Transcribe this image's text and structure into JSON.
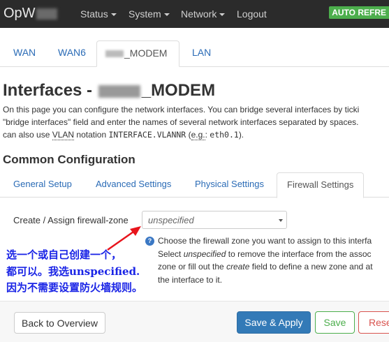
{
  "navbar": {
    "brand": "OpW",
    "menu": [
      {
        "label": "Status",
        "has_caret": true
      },
      {
        "label": "System",
        "has_caret": true
      },
      {
        "label": "Network",
        "has_caret": true
      },
      {
        "label": "Logout",
        "has_caret": false
      }
    ],
    "auto_refresh": "AUTO REFRE"
  },
  "interface_tabs": [
    "WAN",
    "WAN6",
    "_MODEM",
    "LAN"
  ],
  "page": {
    "title_prefix": "Interfaces - ",
    "title_suffix": "_MODEM",
    "description": {
      "line1": "On this page you can configure the network interfaces. You can bridge several interfaces by ticki",
      "line2": "\"bridge interfaces\" field and enter the names of several network interfaces separated by spaces.",
      "line3_a": "can also use ",
      "vlan": "VLAN",
      "line3_b": " notation ",
      "code1": "INTERFACE.VLANNR",
      "line3_c": " (",
      "eg": "e.g.",
      "line3_d": ": ",
      "code2": "eth0.1",
      "line3_e": ")."
    }
  },
  "section": {
    "title": "Common Configuration",
    "tabs": [
      "General Setup",
      "Advanced Settings",
      "Physical Settings",
      "Firewall Settings"
    ],
    "active_tab": "Firewall Settings"
  },
  "firewall": {
    "label": "Create / Assign firewall-zone",
    "select_value": "unspecified",
    "help": {
      "line1": "Choose the firewall zone you want to assign to this interfa",
      "line2_a": "Select ",
      "line2_em": "unspecified",
      "line2_b": " to remove the interface from the assoc",
      "line3_a": "zone or fill out the ",
      "line3_em": "create",
      "line3_b": " field to define a new zone and at",
      "line4": "the interface to it."
    }
  },
  "annotation": {
    "line1": "选一个或自己创建一个，",
    "line2": "都可以。我选unspecified.",
    "line3": "因为不需要设置防火墙规则。",
    "color": "#1a24e6",
    "arrow_color": "#e8141c"
  },
  "footer": {
    "back": "Back to Overview",
    "save_apply": "Save & Apply",
    "save": "Save",
    "reset": "Rese"
  }
}
